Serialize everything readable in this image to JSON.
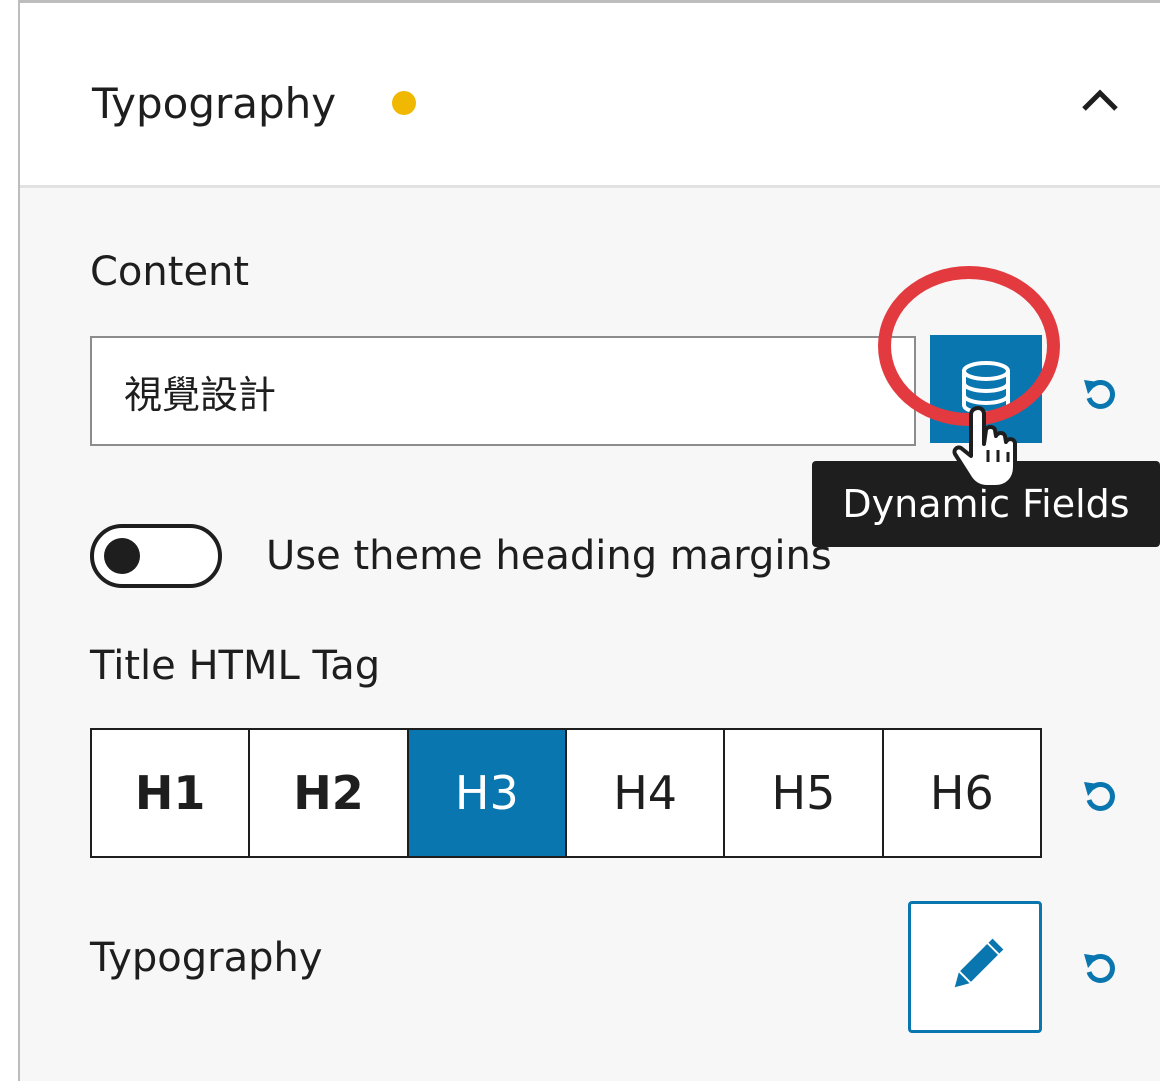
{
  "section": {
    "title": "Typography",
    "modified_dot_color": "#f0b800"
  },
  "content": {
    "label": "Content",
    "value": "視覺設計",
    "dynamic_fields_tooltip": "Dynamic Fields"
  },
  "theme_margins": {
    "label": "Use theme heading margins",
    "enabled": false
  },
  "title_tag": {
    "label": "Title HTML Tag",
    "options": [
      "H1",
      "H2",
      "H3",
      "H4",
      "H5",
      "H6"
    ],
    "selected": "H3"
  },
  "typography": {
    "label": "Typography"
  },
  "colors": {
    "accent": "#0a76b0",
    "highlight_circle": "#e23a3f"
  },
  "icons": {
    "collapse": "chevron-up-icon",
    "dynamic_fields": "database-icon",
    "reset": "reset-icon",
    "edit": "pencil-icon",
    "cursor": "hand-pointer-icon"
  }
}
